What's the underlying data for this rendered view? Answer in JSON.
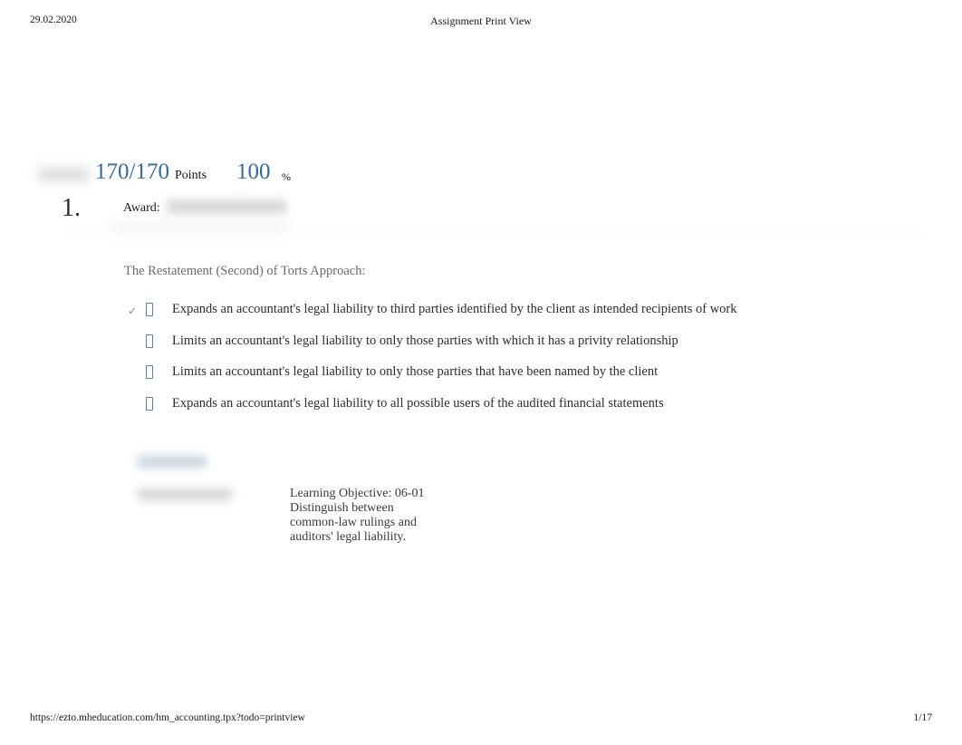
{
  "header": {
    "date": "29.02.2020",
    "title": "Assignment Print View"
  },
  "footer": {
    "url": "https://ezto.mheducation.com/hm_accounting.tpx?todo=printview",
    "page": "1/17"
  },
  "score": {
    "points_value": "170/170",
    "points_label": "Points",
    "percent_value": "100",
    "percent_label": "%",
    "accent_color": "#36699c"
  },
  "question": {
    "number": "1.",
    "award_label": "Award:",
    "stem": "The Restatement (Second) of Torts Approach:",
    "options": [
      {
        "text": "Expands an accountant's legal liability to third parties identified by the client as intended recipients of work",
        "selected": true,
        "check_glyph": "✓"
      },
      {
        "text": "Limits an accountant's legal liability to only those parties with which it has a privity relationship",
        "selected": false,
        "check_glyph": ""
      },
      {
        "text": "Limits an accountant's legal liability to only those parties that have been named by the client",
        "selected": false,
        "check_glyph": ""
      },
      {
        "text": "Expands an accountant's legal liability to all possible users of the audited financial statements",
        "selected": false,
        "check_glyph": ""
      }
    ]
  },
  "learning_objective": {
    "line1": "Learning Objective: 06-01",
    "line2": "Distinguish between",
    "line3": "common-law rulings and",
    "line4": "auditors' legal liability."
  }
}
